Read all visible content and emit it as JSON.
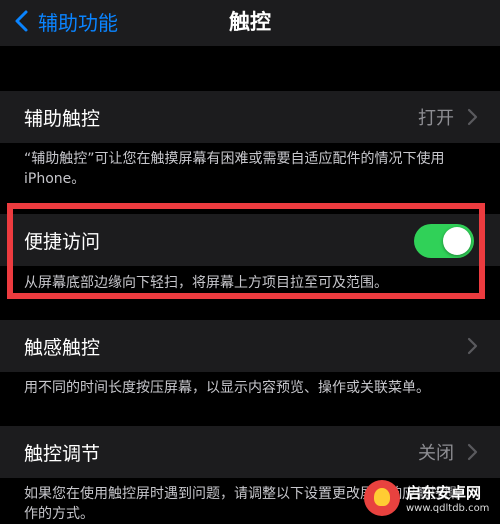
{
  "nav": {
    "back_label": "辅助功能",
    "title": "触控"
  },
  "rows": [
    {
      "label": "辅助触控",
      "value": "打开",
      "footnote": "“辅助触控”可让您在触摸屏幕有困难或需要自适应配件的情况下使用iPhone。"
    },
    {
      "label": "便捷访问",
      "toggle_on": true,
      "footnote": "从屏幕底部边缘向下轻扫，将屏幕上方项目拉至可及范围。"
    },
    {
      "label": "触感触控",
      "footnote": "用不同的时间长度按压屏幕，以显示内容预览、操作或关联菜单。"
    },
    {
      "label": "触控调节",
      "value": "关闭",
      "footnote": "如果您在使用触控屏时遇到问题，请调整以下设置更改屏幕响应触控操作的方式。"
    }
  ],
  "watermark": {
    "line1": "启东安卓网",
    "line2": "www.qdltdb.com"
  },
  "colors": {
    "accent": "#0a84ff",
    "toggle_on": "#30d158",
    "highlight": "#ec3b3f"
  }
}
